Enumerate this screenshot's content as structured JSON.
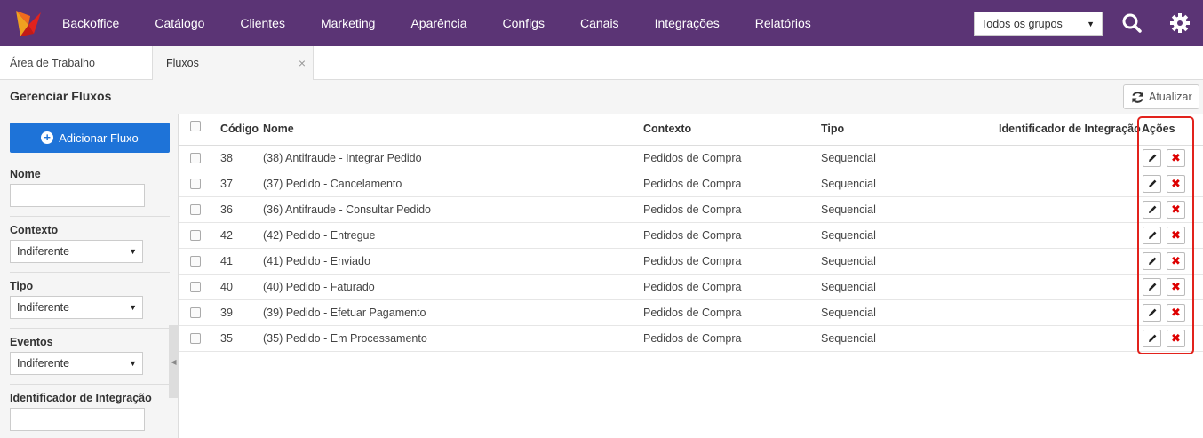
{
  "nav": {
    "items": [
      "Backoffice",
      "Catálogo",
      "Clientes",
      "Marketing",
      "Aparência",
      "Configs",
      "Canais",
      "Integrações",
      "Relatórios"
    ],
    "group_select": "Todos os grupos",
    "search_icon": "search-icon",
    "settings_icon": "gear-icon"
  },
  "tabs": {
    "workspace": "Área de Trabalho",
    "active": "Fluxos",
    "close": "×"
  },
  "page": {
    "title": "Gerenciar Fluxos",
    "refresh_label": "Atualizar"
  },
  "filters": {
    "add_label": "Adicionar Fluxo",
    "name_label": "Nome",
    "context_label": "Contexto",
    "context_value": "Indiferente",
    "type_label": "Tipo",
    "type_value": "Indiferente",
    "events_label": "Eventos",
    "events_value": "Indiferente",
    "integration_label": "Identificador de Integração"
  },
  "table": {
    "headers": {
      "code": "Código",
      "name": "Nome",
      "context": "Contexto",
      "type": "Tipo",
      "integration": "Identificador de Integração",
      "actions": "Ações"
    },
    "rows": [
      {
        "code": "38",
        "name": "(38) Antifraude - Integrar Pedido",
        "context": "Pedidos de Compra",
        "type": "Sequencial"
      },
      {
        "code": "37",
        "name": "(37) Pedido - Cancelamento",
        "context": "Pedidos de Compra",
        "type": "Sequencial"
      },
      {
        "code": "36",
        "name": "(36) Antifraude - Consultar Pedido",
        "context": "Pedidos de Compra",
        "type": "Sequencial"
      },
      {
        "code": "42",
        "name": "(42) Pedido - Entregue",
        "context": "Pedidos de Compra",
        "type": "Sequencial"
      },
      {
        "code": "41",
        "name": "(41) Pedido - Enviado",
        "context": "Pedidos de Compra",
        "type": "Sequencial"
      },
      {
        "code": "40",
        "name": "(40) Pedido - Faturado",
        "context": "Pedidos de Compra",
        "type": "Sequencial"
      },
      {
        "code": "39",
        "name": "(39) Pedido - Efetuar Pagamento",
        "context": "Pedidos de Compra",
        "type": "Sequencial"
      },
      {
        "code": "35",
        "name": "(35) Pedido - Em Processamento",
        "context": "Pedidos de Compra",
        "type": "Sequencial"
      }
    ]
  },
  "colors": {
    "topbar": "#5b3475",
    "primary": "#1e73d8",
    "highlight": "#e2221c",
    "delete": "#dd0000"
  }
}
